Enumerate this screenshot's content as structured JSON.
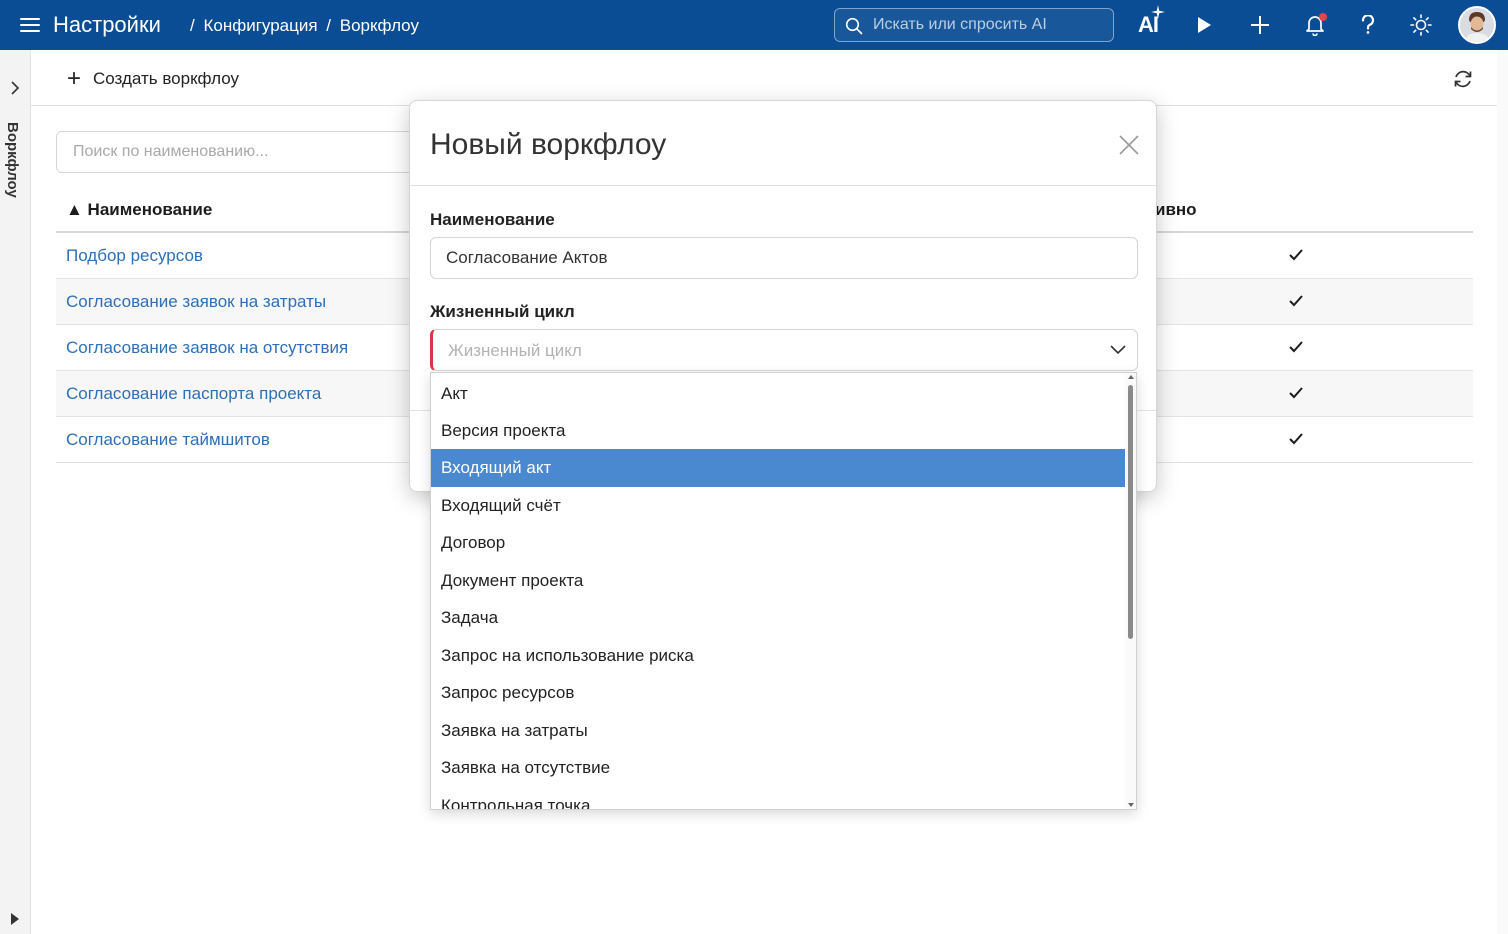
{
  "topbar": {
    "title": "Настройки",
    "breadcrumb": [
      "/",
      "Конфигурация",
      "/",
      "Воркфлоу"
    ],
    "search_placeholder": "Искать или спросить AI",
    "ai_label": "AI",
    "icons": [
      "menu-icon",
      "search-icon",
      "ai-sparkle-icon",
      "play-icon",
      "plus-icon",
      "bell-icon",
      "help-icon",
      "sun-icon",
      "avatar"
    ],
    "accent_color": "#0a4d94",
    "notification_dot_color": "#e8424a"
  },
  "left_panel": {
    "label": "Воркфлоу"
  },
  "toolbar": {
    "create_label": "Создать воркфлоу"
  },
  "list": {
    "filter_placeholder": "Поиск по наименованию...",
    "columns": {
      "name": "▲ Наименование",
      "active": "ивно"
    },
    "rows": [
      {
        "name": "Подбор ресурсов",
        "active": true
      },
      {
        "name": "Согласование заявок на затраты",
        "active": true
      },
      {
        "name": "Согласование заявок на отсутствия",
        "active": true
      },
      {
        "name": "Согласование паспорта проекта",
        "active": true
      },
      {
        "name": "Согласование таймшитов",
        "active": true
      }
    ],
    "link_color": "#2e6fb6"
  },
  "modal": {
    "title": "Новый воркфлоу",
    "name_label": "Наименование",
    "name_value": "Согласование Актов",
    "lifecycle_label": "Жизненный цикл",
    "lifecycle_placeholder": "Жизненный цикл",
    "required_color": "#dc3545"
  },
  "dropdown": {
    "options": [
      "Акт",
      "Версия проекта",
      "Входящий акт",
      "Входящий счёт",
      "Договор",
      "Документ проекта",
      "Задача",
      "Запрос на использование риска",
      "Запрос ресурсов",
      "Заявка на затраты",
      "Заявка на отсутствие",
      "Контрольная точка"
    ],
    "selected": "Входящий акт",
    "selected_color": "#4a89d0"
  }
}
